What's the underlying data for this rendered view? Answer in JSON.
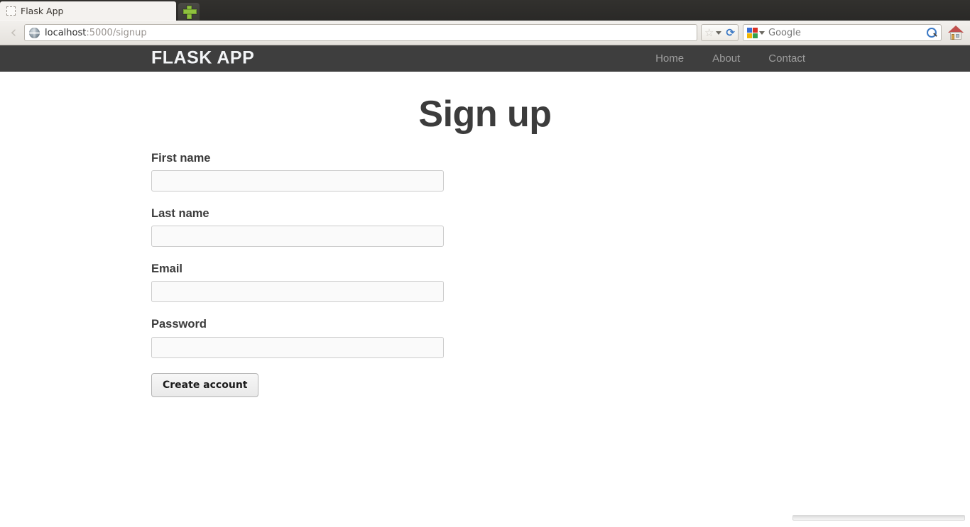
{
  "browser": {
    "tab": {
      "title": "Flask App",
      "favicon": "placeholder-favicon-icon"
    },
    "new_tab_label": "+",
    "back_button": "‹",
    "url": {
      "host": "localhost",
      "path": ":5000/signup",
      "favicon": "globe-icon"
    },
    "bookmark_star": "☆",
    "reload": "⟳",
    "search": {
      "engine": "Google",
      "placeholder": "Google",
      "value": ""
    },
    "home_title": "Home"
  },
  "site": {
    "brand": "FLASK APP",
    "nav": [
      {
        "label": "Home"
      },
      {
        "label": "About"
      },
      {
        "label": "Contact"
      }
    ],
    "navbar_bg": "#3e3e3e",
    "nav_link_color": "#9d9d9d",
    "brand_color": "#f2f4f6"
  },
  "page": {
    "title": "Sign up",
    "title_color": "#3c3c3c"
  },
  "form": {
    "fields": [
      {
        "label": "First name",
        "value": "",
        "placeholder": "",
        "type": "text"
      },
      {
        "label": "Last name",
        "value": "",
        "placeholder": "",
        "type": "text"
      },
      {
        "label": "Email",
        "value": "",
        "placeholder": "",
        "type": "email"
      },
      {
        "label": "Password",
        "value": "",
        "placeholder": "",
        "type": "password"
      }
    ],
    "submit_label": "Create account",
    "input_bg": "#fafafa",
    "input_border": "#cccccc"
  }
}
